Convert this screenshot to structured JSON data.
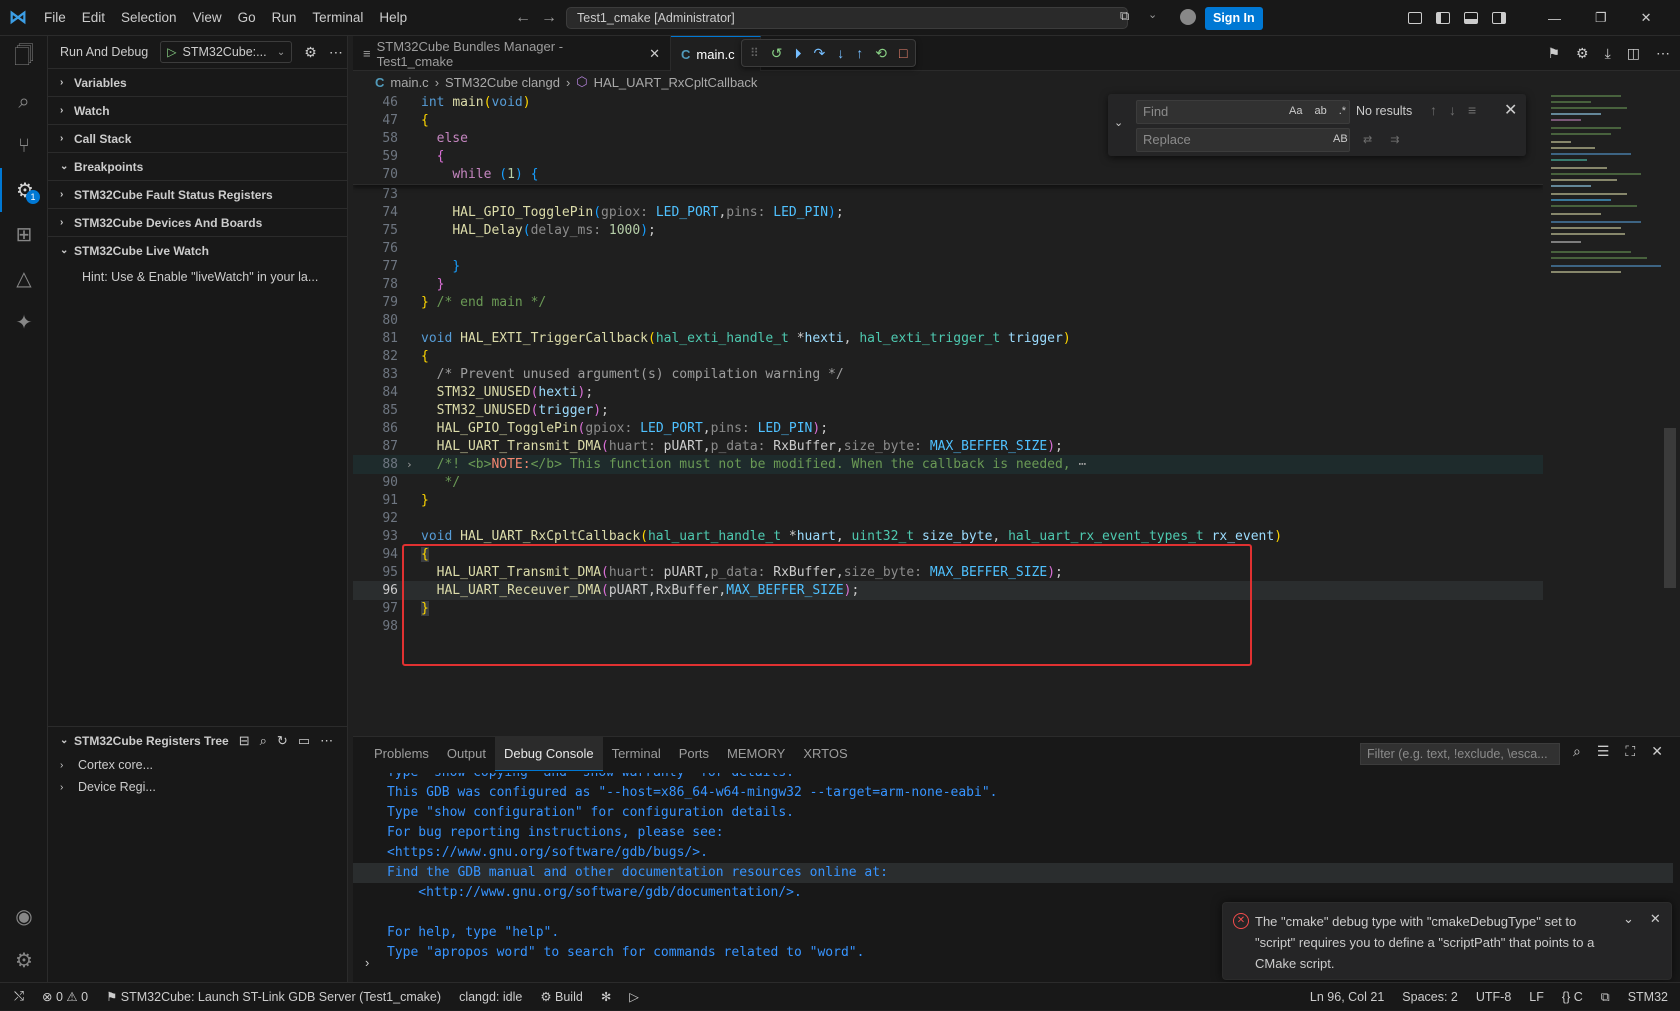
{
  "titlebar": {
    "menu": [
      "File",
      "Edit",
      "Selection",
      "View",
      "Go",
      "Run",
      "Terminal",
      "Help"
    ],
    "command_center": "Test1_cmake [Administrator]",
    "sign_in": "Sign In"
  },
  "sidebar": {
    "title": "Run And Debug",
    "config": "STM32Cube:...",
    "sections": [
      "Variables",
      "Watch",
      "Call Stack",
      "Breakpoints",
      "STM32Cube Fault Status Registers",
      "STM32Cube Devices And Boards",
      "STM32Cube Live Watch"
    ],
    "live_watch_hint": "Hint: Use & Enable \"liveWatch\" in your la...",
    "registers_title": "STM32Cube Registers Tree",
    "registers_items": [
      "Cortex core...",
      "Device Regi..."
    ]
  },
  "activity_badge": "1",
  "tabs": [
    {
      "label": "STM32Cube Bundles Manager - Test1_cmake",
      "icon": "≡"
    },
    {
      "label": "main.c",
      "icon": "C"
    }
  ],
  "breadcrumb": [
    "main.c",
    "STM32Cube clangd",
    "HAL_UART_RxCpltCallback"
  ],
  "find": {
    "find_placeholder": "Find",
    "replace_placeholder": "Replace",
    "result": "No results",
    "opt_case": "Aa",
    "opt_word": "ab",
    "opt_regex": ".*",
    "opt_preserve": "AB"
  },
  "panel": {
    "tabs": [
      "Problems",
      "Output",
      "Debug Console",
      "Terminal",
      "Ports",
      "MEMORY",
      "XRTOS"
    ],
    "active_tab": "Debug Console",
    "filter_placeholder": "Filter (e.g. text, !exclude, \\esca...",
    "console_lines": [
      "Type \"show copying\" and \"show warranty\" for details.",
      "This GDB was configured as \"--host=x86_64-w64-mingw32 --target=arm-none-eabi\".",
      "Type \"show configuration\" for configuration details.",
      "For bug reporting instructions, please see:",
      "<https://www.gnu.org/software/gdb/bugs/>.",
      "Find the GDB manual and other documentation resources online at:",
      "    <http://www.gnu.org/software/gdb/documentation/>.",
      "",
      "For help, type \"help\".",
      "Type \"apropos word\" to search for commands related to \"word\"."
    ],
    "prompt": "›"
  },
  "notification": {
    "message": "The \"cmake\" debug type with \"cmakeDebugType\" set to \"script\" requires you to define a \"scriptPath\" that points to a CMake script."
  },
  "statusbar": {
    "errors": "0",
    "warnings": "0",
    "launch": "STM32Cube: Launch ST-Link GDB Server (Test1_cmake)",
    "clangd": "clangd: idle",
    "build": "Build",
    "position": "Ln 96, Col 21",
    "spaces": "Spaces: 2",
    "encoding": "UTF-8",
    "eol": "LF",
    "language": "C",
    "right_label": "STM32"
  },
  "colors": {
    "accent": "#0078d4",
    "highlight_box": "#e03131",
    "error": "#f14c4c"
  }
}
